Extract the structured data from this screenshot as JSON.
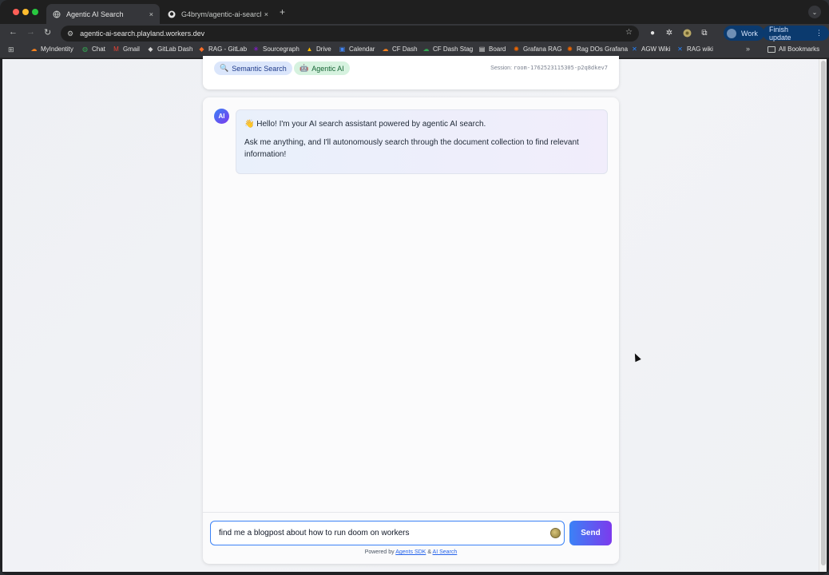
{
  "browser": {
    "tabs": [
      {
        "title": "Agentic AI Search",
        "favicon": "globe-icon",
        "active": true
      },
      {
        "title": "G4brym/agentic-ai-search: i",
        "favicon": "github-icon",
        "active": false
      }
    ],
    "new_tab": "+",
    "tab_close": "×",
    "url": "agentic-ai-search.playland.workers.dev",
    "profile_label": "Work",
    "finish_update_label": "Finish update",
    "bookmarks": [
      {
        "label": "MyIndentity",
        "icon": "cloudflare-icon"
      },
      {
        "label": "Chat",
        "icon": "chat-icon"
      },
      {
        "label": "Gmail",
        "icon": "gmail-icon"
      },
      {
        "label": "GitLab Dash",
        "icon": "gitlab-icon"
      },
      {
        "label": "RAG - GitLab",
        "icon": "gitlab-icon"
      },
      {
        "label": "Sourcegraph",
        "icon": "sourcegraph-icon"
      },
      {
        "label": "Drive",
        "icon": "drive-icon"
      },
      {
        "label": "Calendar",
        "icon": "calendar-icon"
      },
      {
        "label": "CF Dash",
        "icon": "cloudflare-icon"
      },
      {
        "label": "CF Dash Stag",
        "icon": "cloudflare-icon"
      },
      {
        "label": "Board",
        "icon": "board-icon"
      },
      {
        "label": "Grafana RAG",
        "icon": "grafana-icon"
      },
      {
        "label": "Rag DOs Grafana",
        "icon": "grafana-icon"
      },
      {
        "label": "AGW Wiki",
        "icon": "confluence-icon"
      },
      {
        "label": "RAG wiki",
        "icon": "confluence-icon"
      }
    ],
    "all_bookmarks_label": "All Bookmarks",
    "more_bookmarks": "»"
  },
  "app": {
    "badges": [
      {
        "label": "Semantic Search",
        "icon": "magnifier-icon"
      },
      {
        "label": "Agentic AI",
        "icon": "robot-icon"
      }
    ],
    "session_label": "Session:",
    "session_id": "room-1762523115305-p2q8dkev7",
    "ai_avatar_label": "AI",
    "messages": [
      {
        "role": "assistant",
        "greeting": "👋 Hello! I'm your AI search assistant powered by agentic AI search.",
        "body": "Ask me anything, and I'll autonomously search through the document collection to find relevant information!"
      }
    ],
    "input_value": "find me a blogpost about how to run doom on workers",
    "send_label": "Send",
    "footer": {
      "prefix": "Powered by",
      "link1": "Agents SDK",
      "joiner": "&",
      "link2": "AI Search"
    }
  }
}
